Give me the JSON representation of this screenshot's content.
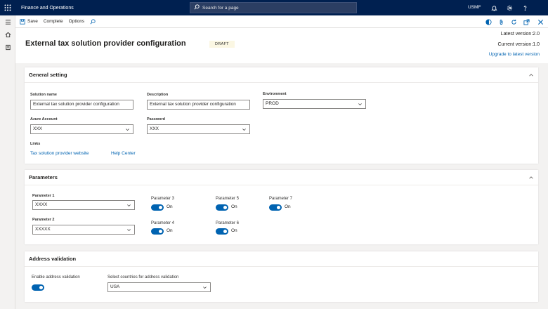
{
  "topbar": {
    "app_title": "Finance and Operations",
    "search_placeholder": "Search for a page",
    "company": "USMF",
    "icons": [
      "waffle-icon",
      "search-icon",
      "bell-icon",
      "gear-icon",
      "help-icon"
    ]
  },
  "actions": {
    "save": "Save",
    "complete": "Complete",
    "options": "Options"
  },
  "header": {
    "title": "External tax solution provider configuration",
    "status": "DRAFT",
    "latest_version": "Latest version:2.0",
    "current_version": "Current version:1.0",
    "upgrade_link": "Upgrade to latest version"
  },
  "general": {
    "heading": "General setting",
    "solution_name_label": "Solution name",
    "solution_name_value": "External tax solution provider configuration",
    "description_label": "Description",
    "description_value": "External tax solution provider configuration",
    "environment_label": "Environment",
    "environment_value": "PROD",
    "azure_label": "Azure Account",
    "azure_value": "XXX",
    "password_label": "Password",
    "password_value": "XXX",
    "links_label": "Links",
    "link_provider": "Tax solution provider website",
    "link_help": "Help Center"
  },
  "parameters": {
    "heading": "Parameters",
    "p1_label": "Parameter 1",
    "p1_value": "XXXX",
    "p2_label": "Parameter 2",
    "p2_value": "XXXXX",
    "p3_label": "Parameter 3",
    "p4_label": "Parameter 4",
    "p5_label": "Parameter 5",
    "p6_label": "Parameter 6",
    "p7_label": "Parameter 7",
    "on": "On"
  },
  "address": {
    "heading": "Address validation",
    "enable_label": "Enable address validation",
    "countries_label": "Select countries for address validation",
    "countries_value": "USA"
  },
  "colors": {
    "topbar": "#002050",
    "accent": "#0063b1"
  }
}
